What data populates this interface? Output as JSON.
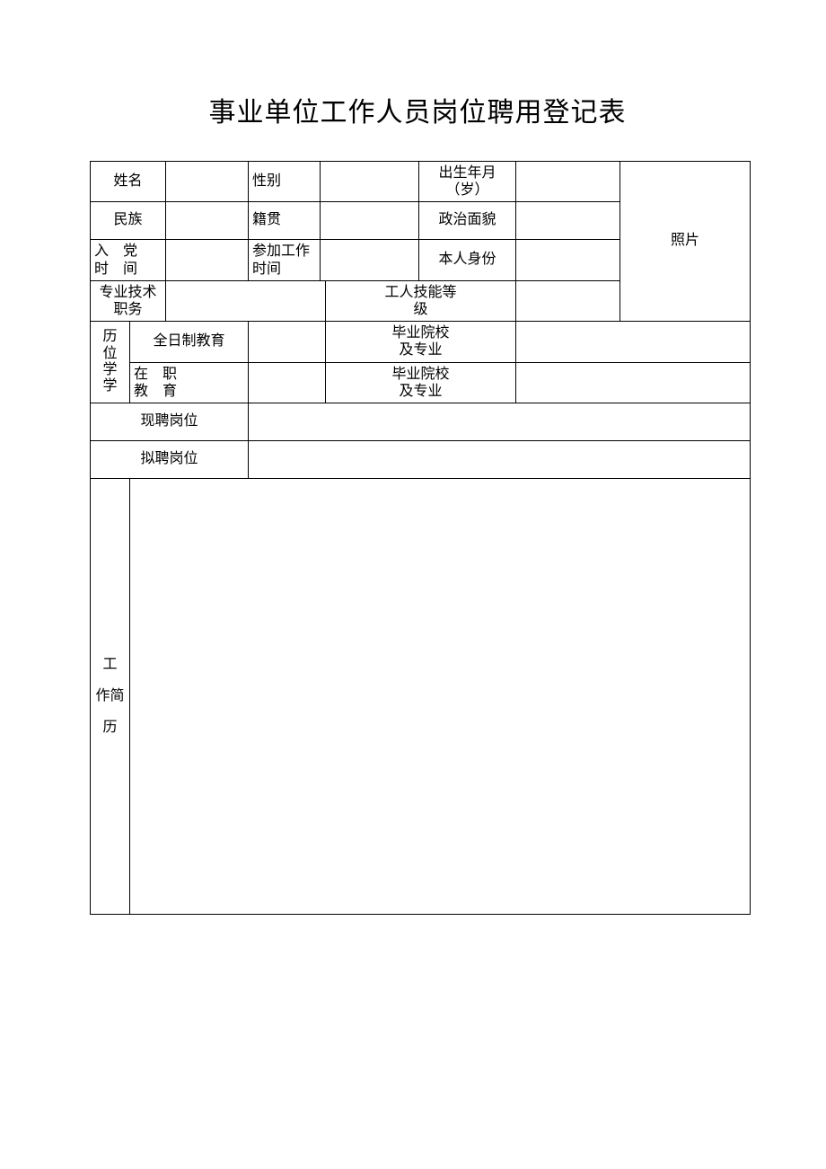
{
  "title": "事业单位工作人员岗位聘用登记表",
  "labels": {
    "name": "姓名",
    "gender": "性别",
    "birth": "出生年月\n（岁）",
    "ethnicity": "民族",
    "native_place": "籍贯",
    "political": "政治面貌",
    "party_join": "入　党\n时　间",
    "work_start": "参加工作\n时间",
    "identity": "本人身份",
    "pro_title": "专业技术\n职务",
    "skill_level": "工人技能等\n级",
    "education_degree": "历\n位\n学\n学",
    "fulltime_edu": "全日制教育",
    "onjob_edu": "在　职\n教　育",
    "grad_school": "毕业院校\n及专业",
    "current_post": "现聘岗位",
    "proposed_post": "拟聘岗位",
    "photo": "照片",
    "work_history": "工\n作简\n历"
  },
  "values": {
    "name": "",
    "gender": "",
    "birth": "",
    "ethnicity": "",
    "native_place": "",
    "political": "",
    "party_join": "",
    "work_start": "",
    "identity": "",
    "pro_title": "",
    "skill_level": "",
    "fulltime_edu": "",
    "fulltime_school": "",
    "onjob_edu": "",
    "onjob_school": "",
    "current_post": "",
    "proposed_post": "",
    "work_history": ""
  }
}
